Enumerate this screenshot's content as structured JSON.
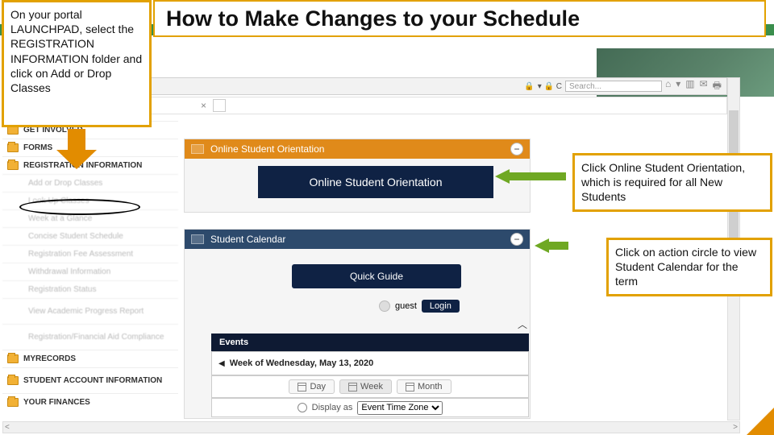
{
  "title": "How to Make Changes to your Schedule",
  "callouts": {
    "left": "On your portal LAUNCHPAD, select the REGISTRATION INFORMATION folder and click on Add or Drop Classes",
    "topRight": "Click Online Student Orientation, which is required for all New Students",
    "midRight": "Click on action circle to view Student Calendar for the term"
  },
  "ie": {
    "home": "home",
    "searchPlaceholder": "Search...",
    "tabClose": "×"
  },
  "sidebar": {
    "folders": {
      "getInvolved": "GET INVOLVED",
      "forms": "FORMS",
      "regInfo": "REGISTRATION INFORMATION",
      "myRecords": "MYRECORDS",
      "sai": "STUDENT ACCOUNT INFORMATION",
      "finances": "YOUR FINANCES"
    },
    "regItems": [
      "Add or Drop Classes",
      "Look Up Classes",
      "Week at a Glance",
      "Concise Student Schedule",
      "Registration Fee Assessment",
      "Withdrawal Information",
      "Registration Status",
      "View Academic Progress Report",
      "Registration/Financial Aid Compliance"
    ]
  },
  "panels": {
    "orientationHeader": "Online Student Orientation",
    "orientationButton": "Online Student Orientation",
    "calendarHeader": "Student Calendar",
    "quickGuide": "Quick Guide",
    "guestLabel": "guest",
    "loginLabel": "Login",
    "chev": "︿"
  },
  "events": {
    "barLabel": "Events",
    "weekLabel": "Week of Wednesday, May 13, 2020",
    "views": {
      "day": "Day",
      "week": "Week",
      "month": "Month"
    },
    "tzLabel": "Display as",
    "tzValue": "Event Time Zone"
  },
  "scroll": {
    "left": "<",
    "right": ">"
  }
}
